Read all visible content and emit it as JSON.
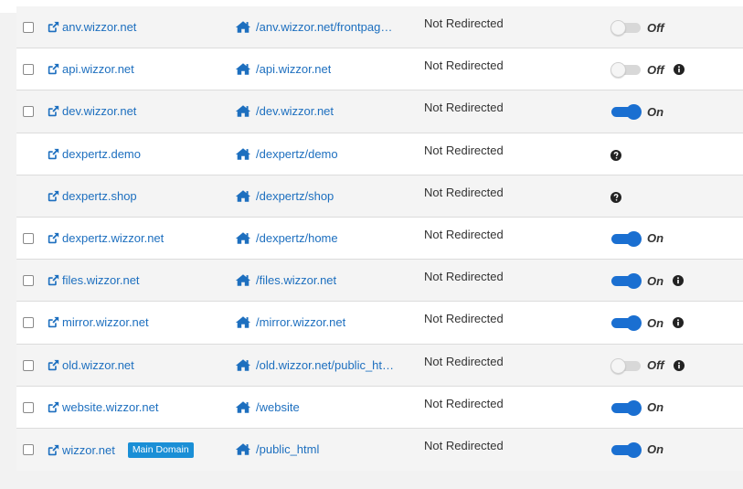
{
  "colors": {
    "link": "#1d6fbf",
    "toggle_on": "#1a6fd1",
    "badge": "#1a8fd6"
  },
  "rows": [
    {
      "domain": "anv.wizzor.net",
      "docroot": "/anv.wizzor.net/frontpag…",
      "status": "Not Redirected",
      "toggle": "Off",
      "checkbox": true,
      "info": false,
      "help": false,
      "badge": ""
    },
    {
      "domain": "api.wizzor.net",
      "docroot": "/api.wizzor.net",
      "status": "Not Redirected",
      "toggle": "Off",
      "checkbox": true,
      "info": true,
      "help": false,
      "badge": ""
    },
    {
      "domain": "dev.wizzor.net",
      "docroot": "/dev.wizzor.net",
      "status": "Not Redirected",
      "toggle": "On",
      "checkbox": true,
      "info": false,
      "help": false,
      "badge": ""
    },
    {
      "domain": "dexpertz.demo",
      "docroot": "/dexpertz/demo",
      "status": "Not Redirected",
      "toggle": "",
      "checkbox": false,
      "info": false,
      "help": true,
      "badge": ""
    },
    {
      "domain": "dexpertz.shop",
      "docroot": "/dexpertz/shop",
      "status": "Not Redirected",
      "toggle": "",
      "checkbox": false,
      "info": false,
      "help": true,
      "badge": ""
    },
    {
      "domain": "dexpertz.wizzor.net",
      "docroot": "/dexpertz/home",
      "status": "Not Redirected",
      "toggle": "On",
      "checkbox": true,
      "info": false,
      "help": false,
      "badge": ""
    },
    {
      "domain": "files.wizzor.net",
      "docroot": "/files.wizzor.net",
      "status": "Not Redirected",
      "toggle": "On",
      "checkbox": true,
      "info": true,
      "help": false,
      "badge": ""
    },
    {
      "domain": "mirror.wizzor.net",
      "docroot": "/mirror.wizzor.net",
      "status": "Not Redirected",
      "toggle": "On",
      "checkbox": true,
      "info": true,
      "help": false,
      "badge": ""
    },
    {
      "domain": "old.wizzor.net",
      "docroot": "/old.wizzor.net/public_ht…",
      "status": "Not Redirected",
      "toggle": "Off",
      "checkbox": true,
      "info": true,
      "help": false,
      "badge": ""
    },
    {
      "domain": "website.wizzor.net",
      "docroot": "/website",
      "status": "Not Redirected",
      "toggle": "On",
      "checkbox": true,
      "info": false,
      "help": false,
      "badge": ""
    },
    {
      "domain": "wizzor.net",
      "docroot": "/public_html",
      "status": "Not Redirected",
      "toggle": "On",
      "checkbox": true,
      "info": false,
      "help": false,
      "badge": "Main Domain"
    }
  ]
}
